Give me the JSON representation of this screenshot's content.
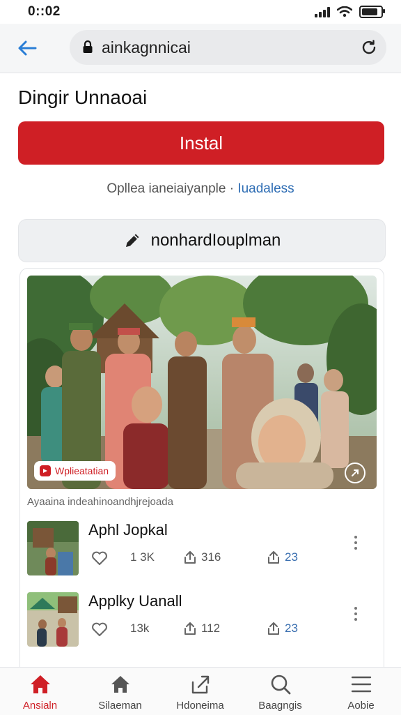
{
  "status_bar": {
    "time": "0::02"
  },
  "browser": {
    "url": "ainkagnnicai"
  },
  "page": {
    "title": "Dingir Unnaoai",
    "install_label": "Instal",
    "info_text": "Opllea ianeiaiyanple",
    "info_separator": " · ",
    "info_link": "Iuadaless",
    "action_label": "nonhardIouplman"
  },
  "feed": {
    "hero_badge": "Wplieatatian",
    "caption": "Ayaaina indeahinoandhjrejoada",
    "items": [
      {
        "title": "Aphl Jopkal",
        "likes": "1 3K",
        "shares": "316",
        "saves": "23"
      },
      {
        "title": "Applky Uanall",
        "likes": "13k",
        "shares": "112",
        "saves": "23"
      }
    ]
  },
  "bottom_nav": [
    {
      "label": "Ansialn",
      "icon": "home-icon",
      "active": true
    },
    {
      "label": "Silaeman",
      "icon": "house-outline-icon",
      "active": false
    },
    {
      "label": "Hdoneima",
      "icon": "share-icon",
      "active": false
    },
    {
      "label": "Baagngis",
      "icon": "search-icon",
      "active": false
    },
    {
      "label": "Aobie",
      "icon": "menu-icon",
      "active": false
    }
  ],
  "colors": {
    "accent": "#cf1f25",
    "link": "#2e6db4"
  }
}
